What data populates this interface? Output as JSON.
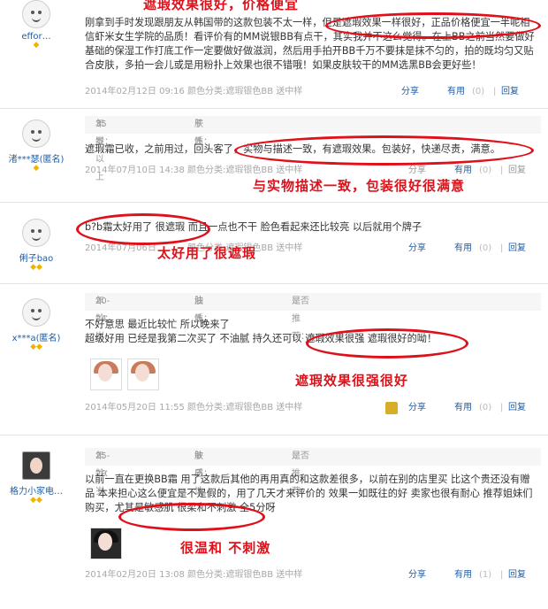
{
  "labels": {
    "share": "分享",
    "useful": "有用",
    "reply": "回复",
    "age_prefix": "年龄：",
    "skin_prefix": "肤质：",
    "recommend_prefix": "是否推荐："
  },
  "reviews": [
    {
      "user": "effor…",
      "content": "刚拿到手时发现跟朋友从韩国带的这款包装不太一样，但是遮瑕效果一样很好，正品价格便宜一半呢相信虾米女生学院的品质！看评价有的MM说银BB有点干，其实我并不这么觉得。在上BB之前当然要做好基础的保湿工作打底工作一定要做好做滋润，然后用手拍开BB千万不要抹是抹不匀的，拍的既均匀又贴合皮肤，多拍一会儿或是用粉扑上效果也很不错哦！如果皮肤较干的MM选黑BB会更好些！",
      "date": "2014年02月12日 09:16",
      "color": "颜色分类:遮瑕银色BB 送中样",
      "useful_count": "0",
      "annotation": "遮瑕效果很好，价格便宜"
    },
    {
      "user": "渚***瑟(匿名)",
      "age": "35岁以上",
      "skin": "干性",
      "content": "遮瑕霜已收，之前用过，回头客了，实物与描述一致，有遮瑕效果。包装好，快递尽责，满意。",
      "date": "2014年07月10日 14:38",
      "color": "颜色分类:遮瑕银色BB 送中样",
      "useful_count": "0",
      "annotation": "与实物描述一致，包装很好很满意"
    },
    {
      "user": "俐子bao",
      "content": "b?b霜太好用了 很遮瑕 而且一点也不干 脸色看起来还比较亮 以后就用个牌子",
      "date": "2014年07月06日",
      "color": "颜色分类:遮瑕银色BB 送中样",
      "useful_count": "0",
      "annotation": "太好用了很遮瑕"
    },
    {
      "user": "x***a(匿名)",
      "age": "20-24岁",
      "skin": "油性",
      "recommend": "是",
      "content_line1": "不好意思 最近比较忙 所以晚来了",
      "content_line2": "超级好用 已经是我第二次买了 不油腻 持久还可以 遮瑕效果很强 遮瑕很好的呦！",
      "date": "2014年05月20日 11:55",
      "color": "颜色分类:遮瑕银色BB 送中样",
      "useful_count": "0",
      "annotation": "遮瑕效果很强很好"
    },
    {
      "user": "格力小家电…",
      "age": "25-29岁",
      "skin": "敏感性",
      "recommend": "是",
      "content": "以前一直在更换BB霜 用了这款后其他的再用真的和这款差很多，以前在别的店里买 比这个贵还没有赠品 本来担心这么便宜是不是假的，用了几天才来评价的 效果一如既往的好 卖家也很有耐心 推荐姐妹们购买，尤其是敏感肌 很柔和不刺激 全5分呀",
      "date": "2014年02月20日 13:08",
      "color": "颜色分类:遮瑕银色BB 送中样",
      "useful_count": "1",
      "annotation": "很温和   不刺激"
    }
  ]
}
